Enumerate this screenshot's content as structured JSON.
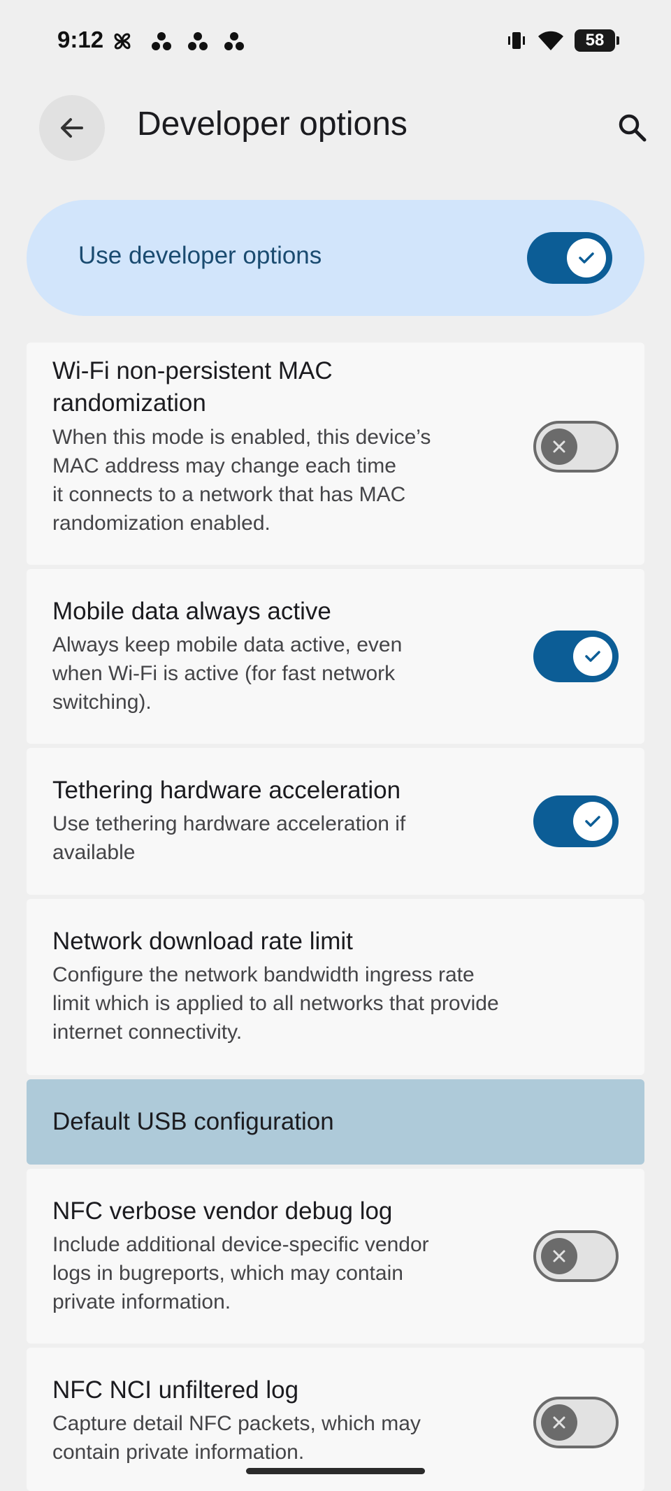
{
  "status_bar": {
    "time": "9:12",
    "battery": "58",
    "icons": [
      "pinwheel-notification-icon",
      "three-dots-notification-icon",
      "three-dots-notification-icon",
      "three-dots-notification-icon",
      "vibrate-icon",
      "wifi-icon",
      "battery-icon"
    ]
  },
  "app_bar": {
    "title": "Developer options",
    "back_icon": "arrow-back-icon",
    "search_icon": "search-icon"
  },
  "master_switch": {
    "label": "Use developer options",
    "checked": true
  },
  "settings": [
    {
      "title_line1": "Wi-Fi non-persistent MAC",
      "title_line2": "randomization",
      "desc": [
        "When this mode is enabled, this device’s",
        "MAC address may change each time",
        "it connects to a network that has MAC",
        "randomization enabled."
      ],
      "checked": false
    },
    {
      "title": "Mobile data always active",
      "desc": [
        "Always keep mobile data active, even",
        "when Wi-Fi is active (for fast network",
        "switching)."
      ],
      "checked": true
    },
    {
      "title": "Tethering hardware acceleration",
      "desc": [
        "Use tethering hardware acceleration if",
        "available"
      ],
      "checked": true
    },
    {
      "title": "Network download rate limit",
      "desc": [
        "Configure the network bandwidth ingress rate",
        "limit which is applied to all networks that provide",
        "internet connectivity."
      ]
    },
    {
      "title": "Default USB configuration"
    },
    {
      "title": "NFC verbose vendor debug log",
      "desc": [
        "Include additional device-specific vendor",
        "logs in bugreports, which may contain",
        "private information."
      ],
      "checked": false
    },
    {
      "title": "NFC NCI unfiltered log",
      "desc": [
        "Capture detail NFC packets, which may",
        "contain private information."
      ],
      "checked": false
    }
  ],
  "colors": {
    "accent": "#0c5d96",
    "master_bg": "#d2e5fb",
    "highlight_bg": "#aecad9",
    "card_bg": "#f8f8f8",
    "page_bg": "#efefef"
  }
}
